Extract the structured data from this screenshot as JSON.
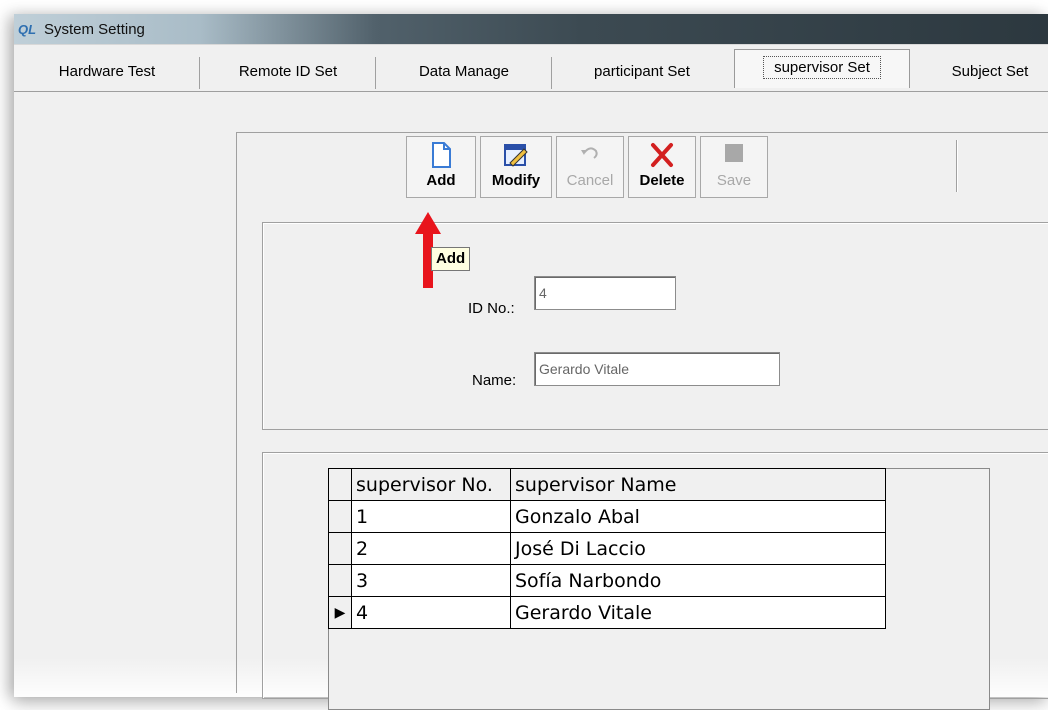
{
  "window": {
    "title": "System Setting",
    "icon_text": "QL"
  },
  "tabs": [
    {
      "label": "Hardware Test"
    },
    {
      "label": "Remote ID Set"
    },
    {
      "label": "Data Manage"
    },
    {
      "label": "participant Set"
    },
    {
      "label": "supervisor Set",
      "active": true
    },
    {
      "label": "Subject Set"
    }
  ],
  "toolbar": {
    "add": "Add",
    "modify": "Modify",
    "cancel": "Cancel",
    "delete": "Delete",
    "save": "Save"
  },
  "tooltip": "Add",
  "form": {
    "id_label": "ID No.:",
    "id_value": "4",
    "name_label": "Name:",
    "name_value": "Gerardo Vitale"
  },
  "grid": {
    "headers": [
      "supervisor No.",
      "supervisor Name"
    ],
    "rows": [
      {
        "no": "1",
        "name": "Gonzalo Abal"
      },
      {
        "no": "2",
        "name": "José Di Laccio"
      },
      {
        "no": "3",
        "name": "Sofía Narbondo"
      },
      {
        "no": "4",
        "name": "Gerardo Vitale",
        "current": true
      }
    ],
    "current_row_marker": "▶"
  },
  "colors": {
    "arrow": "#e8141c",
    "tooltip_bg": "#ffffe1",
    "delete_icon": "#d32020"
  }
}
